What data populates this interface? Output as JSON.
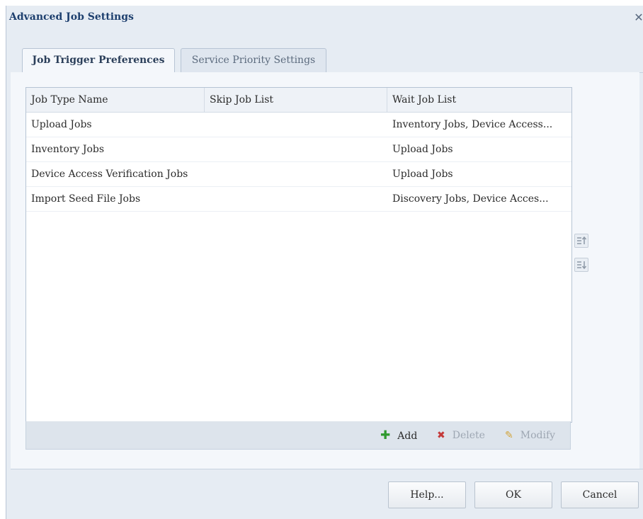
{
  "dialog": {
    "title": "Advanced Job Settings",
    "close_glyph": "✕"
  },
  "tabs": [
    {
      "label": "Job Trigger Preferences",
      "active": true
    },
    {
      "label": "Service Priority Settings",
      "active": false
    }
  ],
  "grid": {
    "columns": [
      "Job Type Name",
      "Skip Job List",
      "Wait Job List"
    ],
    "rows": [
      {
        "name": "Upload Jobs",
        "skip": "",
        "wait": "Inventory Jobs, Device Access..."
      },
      {
        "name": "Inventory Jobs",
        "skip": "",
        "wait": "Upload Jobs"
      },
      {
        "name": "Device Access Verification Jobs",
        "skip": "",
        "wait": "Upload Jobs"
      },
      {
        "name": "Import Seed File Jobs",
        "skip": "",
        "wait": "Discovery Jobs, Device Acces..."
      }
    ]
  },
  "toolbar": {
    "add_label": "Add",
    "add_icon": "plus-icon",
    "delete_label": "Delete",
    "delete_icon": "x-icon",
    "modify_label": "Modify",
    "modify_icon": "pencil-icon"
  },
  "side_buttons": {
    "up_icon": "move-up-icon",
    "down_icon": "move-down-icon"
  },
  "buttons": {
    "help": "Help...",
    "ok": "OK",
    "cancel": "Cancel"
  },
  "colors": {
    "title": "#1d3f6e",
    "add_icon": "#2f9a2f",
    "delete_icon": "#c43a3a",
    "modify_icon": "#d2a43a",
    "dialog_bg": "#e6ecf3"
  }
}
